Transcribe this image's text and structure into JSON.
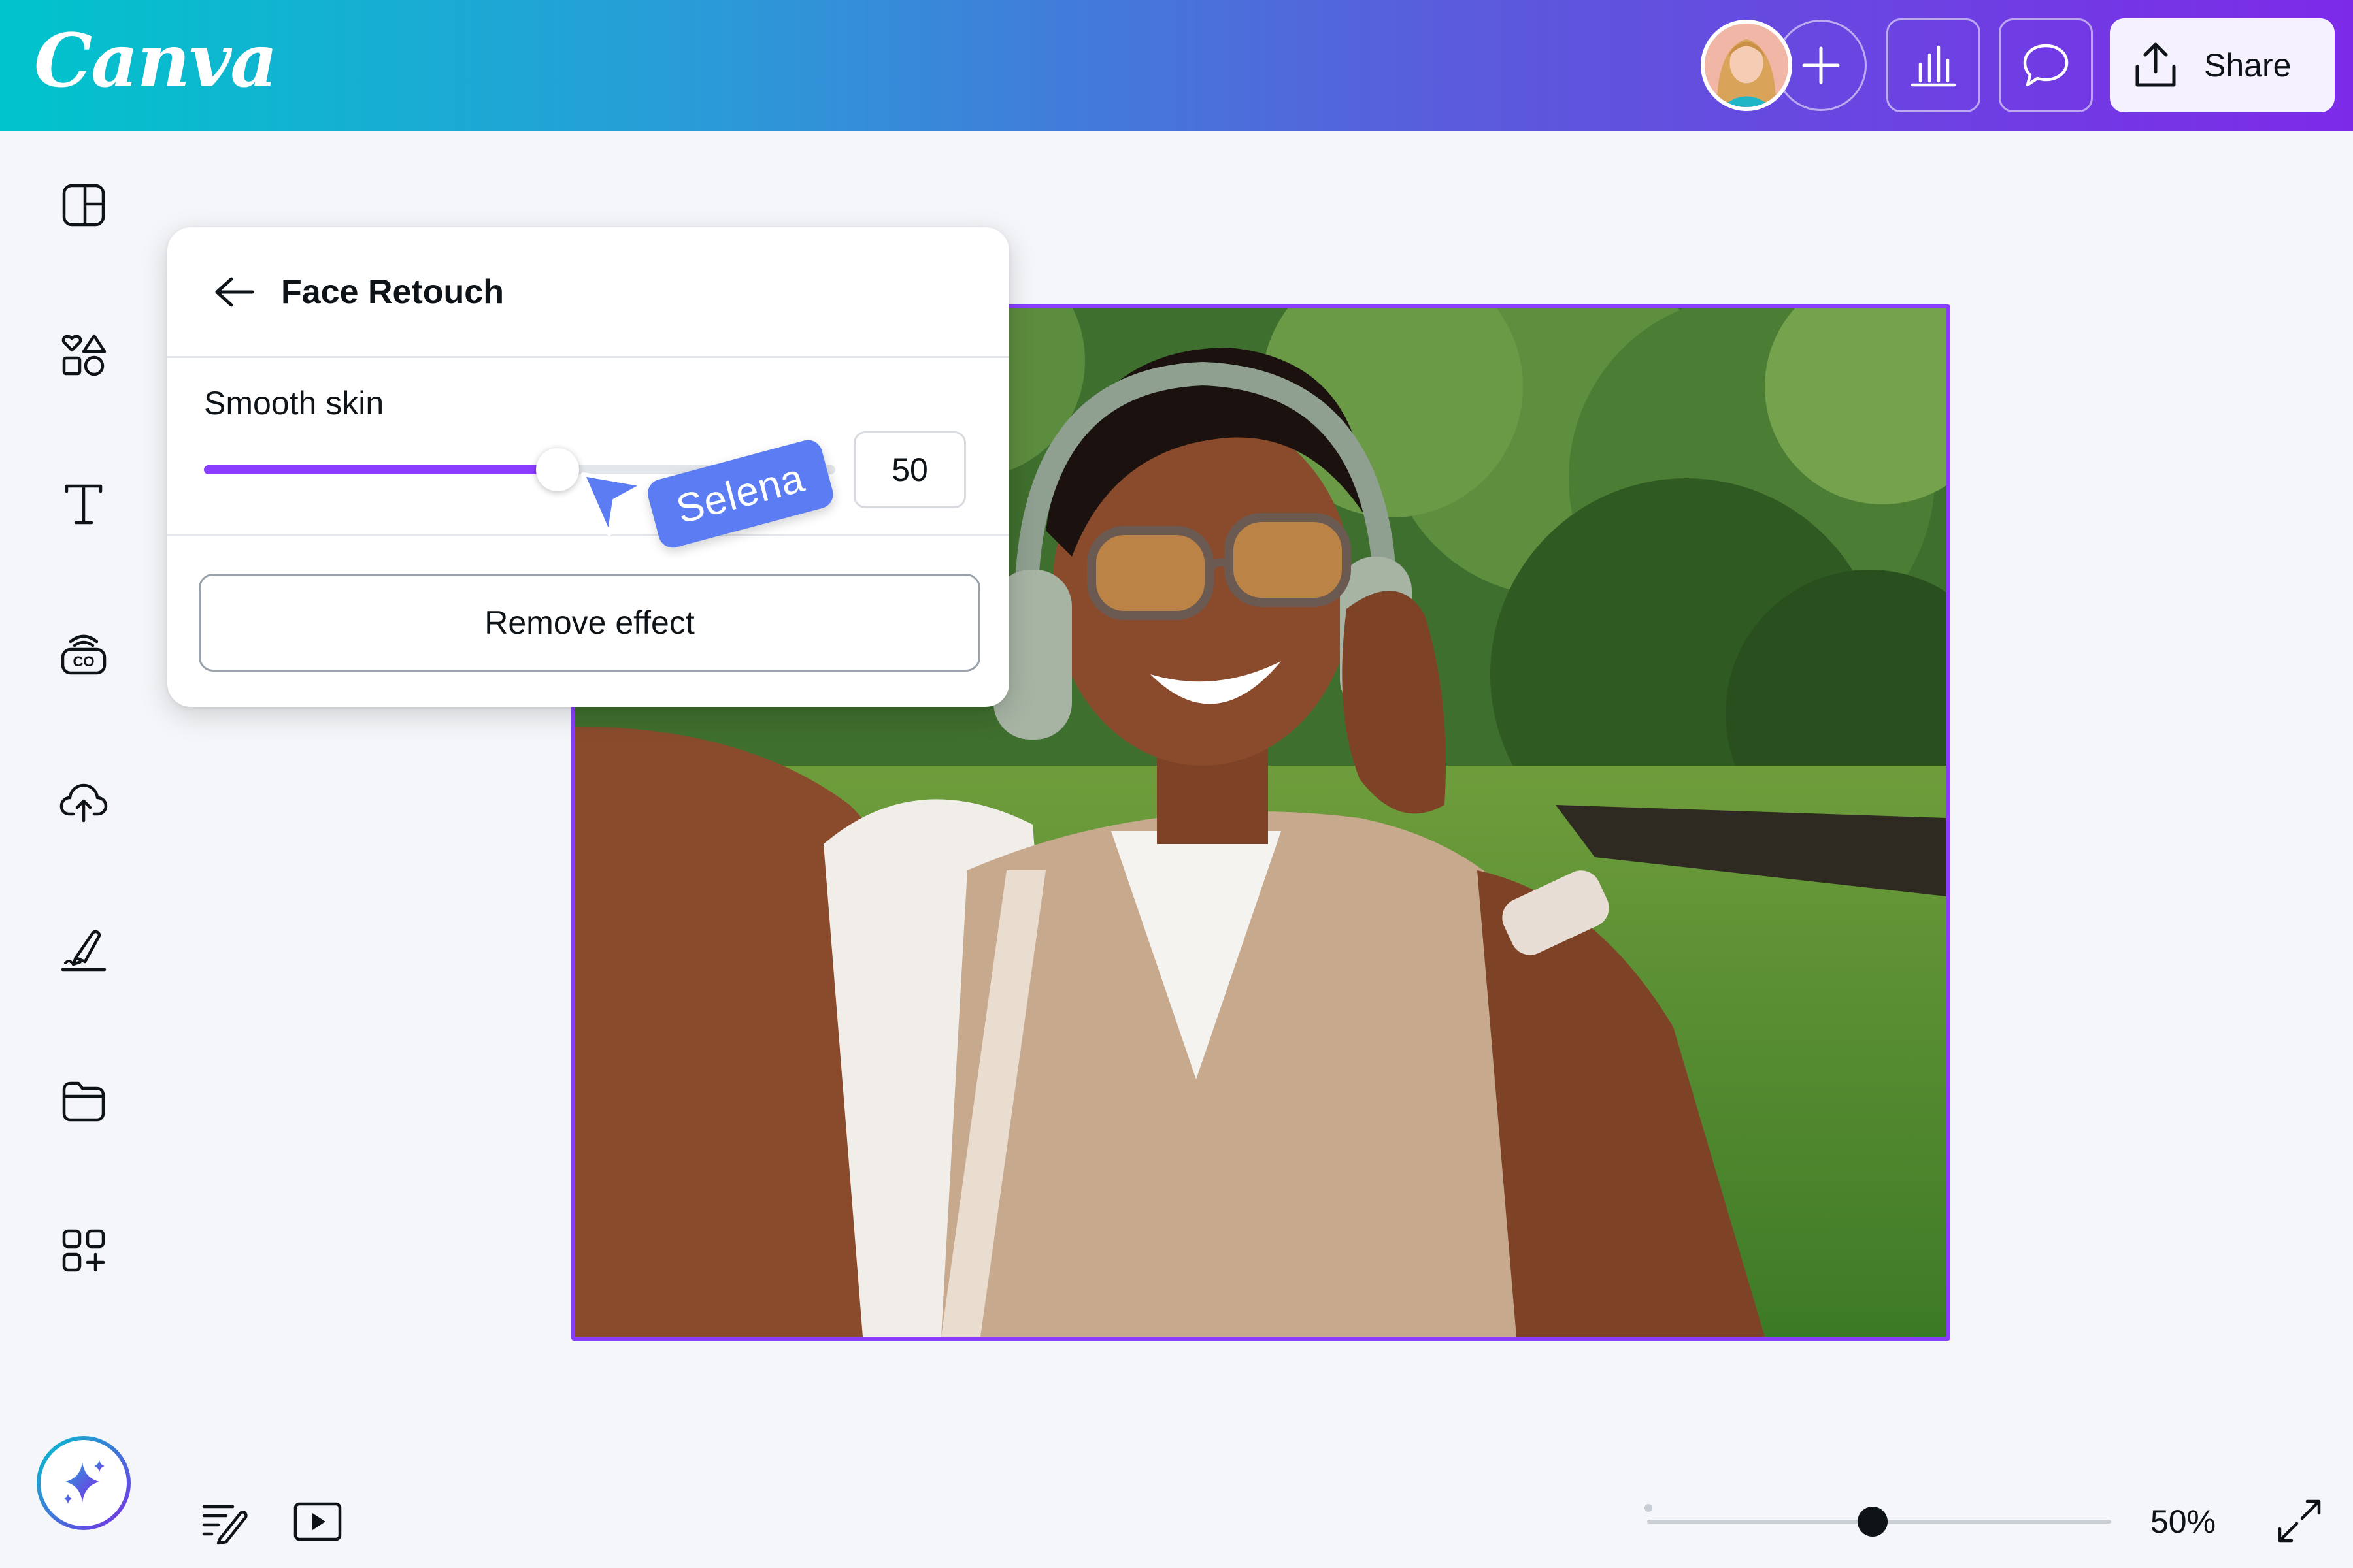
{
  "header": {
    "logo": "Canva",
    "share_label": "Share"
  },
  "panel": {
    "title": "Face Retouch",
    "slider_label": "Smooth skin",
    "slider_value": "50",
    "slider_fraction": 0.56,
    "remove_label": "Remove effect"
  },
  "collaborator": {
    "name": "Selena",
    "color": "#5b7cf2"
  },
  "footer": {
    "zoom_label": "50%"
  },
  "colors": {
    "accent": "#8b3dff",
    "gradient_start": "#00c4cc",
    "gradient_end": "#7d2ae8"
  },
  "icons": {
    "rail": [
      "design-icon",
      "elements-icon",
      "text-icon",
      "brand-icon",
      "uploads-icon",
      "draw-icon",
      "projects-icon",
      "apps-icon"
    ],
    "magic": "sparkle-icon",
    "header": [
      "plus-icon",
      "chart-icon",
      "comment-icon",
      "share-icon"
    ],
    "footer": [
      "notes-icon",
      "present-icon",
      "fullscreen-icon"
    ]
  }
}
